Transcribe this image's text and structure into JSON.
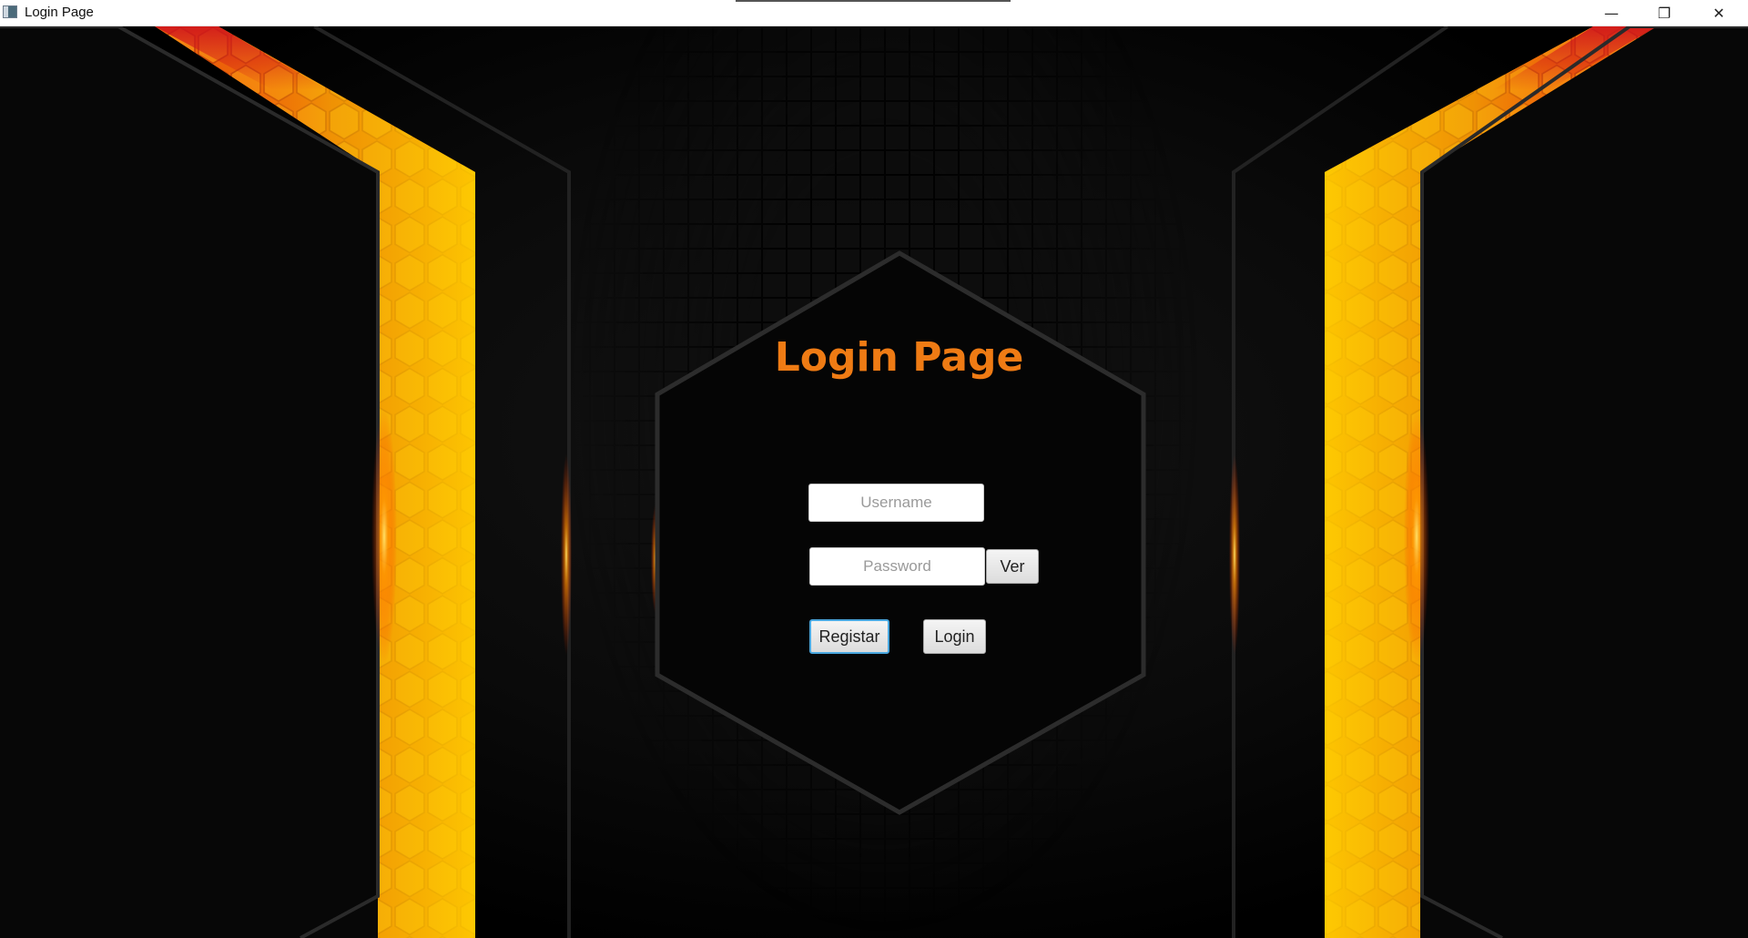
{
  "window": {
    "title": "Login Page",
    "minimize_glyph": "—",
    "restore_glyph": "❐",
    "close_glyph": "✕"
  },
  "icons": {
    "app": "app-window-icon",
    "minimize": "minimize-icon",
    "restore": "restore-icon",
    "close": "close-icon"
  },
  "login": {
    "heading": "Login Page",
    "username_placeholder": "Username",
    "username_value": "",
    "password_placeholder": "Password",
    "password_value": "",
    "show_password_label": "Ver",
    "register_label": "Registar",
    "login_label": "Login"
  },
  "colors": {
    "accent_orange": "#ef7b14",
    "hex_yellow": "#f5b800",
    "hex_orange": "#e8620a",
    "hex_red": "#c4151c",
    "focus_blue": "#4aa8e0"
  }
}
